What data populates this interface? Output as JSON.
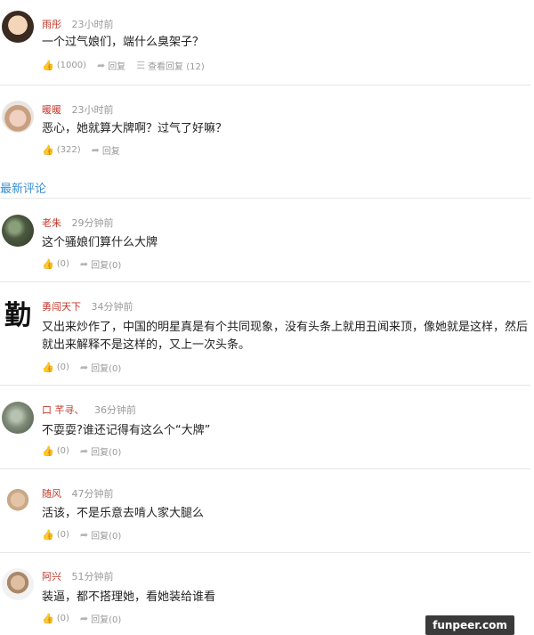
{
  "hot_comments": [
    {
      "user": "雨彤",
      "time": "23小时前",
      "text": "一个过气娘们，端什么臭架子？",
      "likes": "(1000)",
      "reply": "回复",
      "view_replies": "查看回复 (12)"
    },
    {
      "user": "暖暖",
      "time": "23小时前",
      "text": "恶心，她就算大牌啊？过气了好嘛？",
      "likes": "(322)",
      "reply": "回复"
    }
  ],
  "section_title": "最新评论",
  "latest_comments": [
    {
      "user": "老朱",
      "time": "29分钟前",
      "text": "这个骚娘们算什么大牌",
      "likes": "(0)",
      "reply": "回复(0)",
      "avatar_glyph": ""
    },
    {
      "user": "勇闯天下",
      "time": "34分钟前",
      "text": "又出来炒作了，中国的明星真是有个共同现象，没有头条上就用丑闻来顶，像她就是这样，然后就出来解释不是这样的，又上一次头条。",
      "likes": "(0)",
      "reply": "回复(0)",
      "avatar_glyph": "勤"
    },
    {
      "user": "口 芊寻、",
      "time": "36分钟前",
      "text": "不耍耍?谁还记得有这么个“大牌”",
      "likes": "(0)",
      "reply": "回复(0)"
    },
    {
      "user": "随风",
      "time": "47分钟前",
      "text": "活该，不是乐意去啃人家大腿么",
      "likes": "(0)",
      "reply": "回复(0)"
    },
    {
      "user": "阿兴",
      "time": "51分钟前",
      "text": "装逼，都不搭理她，看她装给谁看",
      "likes": "(0)",
      "reply": "回复(0)"
    }
  ],
  "watermark": "funpeer.com",
  "icons": {
    "like": "thumbs-up-icon",
    "reply": "reply-arrow-icon",
    "view": "list-icon"
  },
  "colors": {
    "username": "#c0392b",
    "section_title": "#3a8fcf",
    "meta": "#999999"
  }
}
